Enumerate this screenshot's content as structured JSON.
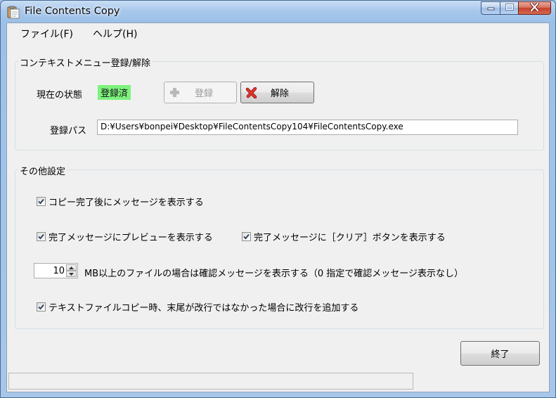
{
  "window": {
    "title": "File Contents Copy"
  },
  "menu": {
    "file": "ファイル(F)",
    "help": "ヘルプ(H)"
  },
  "context_menu_group": {
    "title": "コンテキストメニュー登録/解除",
    "status_label": "現在の状態",
    "status_value": "登録済",
    "register_button": "登録",
    "unregister_button": "解除",
    "path_label": "登録パス",
    "path_value": "D:¥Users¥bonpei¥Desktop¥FileContentsCopy104¥FileContentsCopy.exe"
  },
  "other_settings_group": {
    "title": "その他設定",
    "show_message_after_copy": {
      "label": "コピー完了後にメッセージを表示する",
      "checked": true
    },
    "show_preview": {
      "label": "完了メッセージにプレビューを表示する",
      "checked": true
    },
    "show_clear_button": {
      "label": "完了メッセージに［クリア］ボタンを表示する",
      "checked": true
    },
    "size_threshold": {
      "value": "10",
      "label": "MB以上のファイルの場合は確認メッセージを表示する（0 指定で確認メッセージ表示なし）"
    },
    "append_newline": {
      "label": "テキストファイルコピー時、末尾が改行ではなかった場合に改行を追加する",
      "checked": true
    }
  },
  "footer": {
    "exit_button": "終了",
    "status_text": ""
  },
  "colors": {
    "registered_badge": "#7df27d",
    "close_button": "#c4412c",
    "title_bar": "#9cc0e8"
  },
  "icons": {
    "app": "clipboard-icon",
    "register": "plus-icon",
    "unregister": "red-x-icon"
  }
}
